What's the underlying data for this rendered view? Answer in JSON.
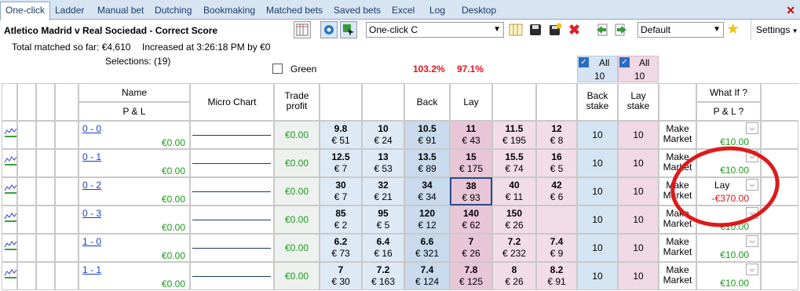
{
  "tabs": [
    "One-click",
    "Ladder",
    "Manual bet",
    "Dutching",
    "Bookmaking",
    "Matched bets",
    "Saved bets",
    "Excel",
    "Log",
    "Desktop"
  ],
  "close_icon": "close-icon",
  "market": {
    "title": "Atletico Madrid v Real Sociedad - Correct Score",
    "total_matched": "Total matched so far: €4,610",
    "increased": "Increased at 3:26:18 PM by €0",
    "selections": "Selections: (19)"
  },
  "toolbar": {
    "profile": "One-click C",
    "layout": "Default",
    "settings": "Settings"
  },
  "green": {
    "label": "Green",
    "checked": false
  },
  "overround": {
    "back": "103.2%",
    "lay": "97.1%"
  },
  "all_back": {
    "label": "All",
    "value": "10",
    "checked": true
  },
  "all_lay": {
    "label": "All",
    "value": "10",
    "checked": true
  },
  "columns": {
    "name": "Name",
    "pl": "P & L",
    "micro_chart": "Micro Chart",
    "trade_profit": "Trade profit",
    "back": "Back",
    "lay": "Lay",
    "back_stake": "Back stake",
    "lay_stake": "Lay stake",
    "what_if": "What If ?",
    "what_if_pl": "P & L ?"
  },
  "rows": [
    {
      "name": "0 - 0",
      "pl": "€0.00",
      "trade": "€0.00",
      "back": [
        {
          "p": "9.8",
          "s": "€ 51"
        },
        {
          "p": "10",
          "s": "€ 24"
        },
        {
          "p": "10.5",
          "s": "€ 91"
        }
      ],
      "lay": [
        {
          "p": "11",
          "s": "€ 43"
        },
        {
          "p": "11.5",
          "s": "€ 195"
        },
        {
          "p": "12",
          "s": "€ 8"
        }
      ],
      "bstake": "10",
      "lstake": "10",
      "mm": "Make Market",
      "wif_label": "",
      "wif_value": "€10.00"
    },
    {
      "name": "0 - 1",
      "pl": "€0.00",
      "trade": "€0.00",
      "back": [
        {
          "p": "12.5",
          "s": "€ 7"
        },
        {
          "p": "13",
          "s": "€ 53"
        },
        {
          "p": "13.5",
          "s": "€ 89"
        }
      ],
      "lay": [
        {
          "p": "15",
          "s": "€ 175"
        },
        {
          "p": "15.5",
          "s": "€ 74"
        },
        {
          "p": "16",
          "s": "€ 5"
        }
      ],
      "bstake": "10",
      "lstake": "10",
      "mm": "Make Market",
      "wif_label": "",
      "wif_value": "€10.00"
    },
    {
      "name": "0 - 2",
      "pl": "€0.00",
      "trade": "€0.00",
      "back": [
        {
          "p": "30",
          "s": "€ 7"
        },
        {
          "p": "32",
          "s": "€ 21"
        },
        {
          "p": "34",
          "s": "€ 34"
        }
      ],
      "lay": [
        {
          "p": "38",
          "s": "€ 93"
        },
        {
          "p": "40",
          "s": "€ 11"
        },
        {
          "p": "42",
          "s": "€ 6"
        }
      ],
      "bstake": "10",
      "lstake": "10",
      "mm": "Make Market",
      "wif_label": "Lay",
      "wif_value": "-€370.00"
    },
    {
      "name": "0 - 3",
      "pl": "€0.00",
      "trade": "€0.00",
      "back": [
        {
          "p": "85",
          "s": "€ 2"
        },
        {
          "p": "95",
          "s": "€ 5"
        },
        {
          "p": "120",
          "s": "€ 12"
        }
      ],
      "lay": [
        {
          "p": "140",
          "s": "€ 62"
        },
        {
          "p": "150",
          "s": "€ 26"
        },
        {
          "p": "",
          "s": ""
        }
      ],
      "bstake": "10",
      "lstake": "10",
      "mm": "Make Market",
      "wif_label": "",
      "wif_value": "€10.00"
    },
    {
      "name": "1 - 0",
      "pl": "€0.00",
      "trade": "€0.00",
      "back": [
        {
          "p": "6.2",
          "s": "€ 73"
        },
        {
          "p": "6.4",
          "s": "€ 16"
        },
        {
          "p": "6.6",
          "s": "€ 321"
        }
      ],
      "lay": [
        {
          "p": "7",
          "s": "€ 26"
        },
        {
          "p": "7.2",
          "s": "€ 232"
        },
        {
          "p": "7.4",
          "s": "€ 9"
        }
      ],
      "bstake": "10",
      "lstake": "10",
      "mm": "Make Market",
      "wif_label": "",
      "wif_value": "€10.00"
    },
    {
      "name": "1 - 1",
      "pl": "€0.00",
      "trade": "€0.00",
      "back": [
        {
          "p": "7",
          "s": "€ 30"
        },
        {
          "p": "7.2",
          "s": "€ 163"
        },
        {
          "p": "7.4",
          "s": "€ 124"
        }
      ],
      "lay": [
        {
          "p": "7.8",
          "s": "€ 125"
        },
        {
          "p": "8",
          "s": "€ 26"
        },
        {
          "p": "8.2",
          "s": "€ 91"
        }
      ],
      "bstake": "10",
      "lstake": "10",
      "mm": "Make Market",
      "wif_label": "",
      "wif_value": "€10.00"
    }
  ]
}
